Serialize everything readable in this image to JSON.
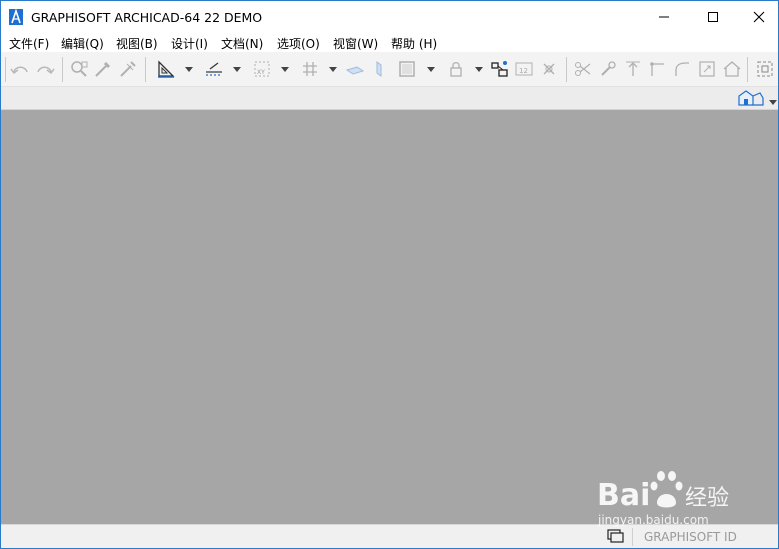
{
  "window": {
    "title": "GRAPHISOFT ARCHICAD-64 22 DEMO"
  },
  "menu": [
    {
      "label": "文件(F)"
    },
    {
      "label": "编辑(Q)"
    },
    {
      "label": "视图(B)"
    },
    {
      "label": "设计(I)"
    },
    {
      "label": "文档(N)"
    },
    {
      "label": "选项(O)"
    },
    {
      "label": "视窗(W)"
    },
    {
      "label": "帮助 (H)"
    }
  ],
  "statusbar": {
    "graphisoft_id": "GRAPHISOFT ID"
  },
  "watermark": {
    "brand": "Bai",
    "brand_suffix": "经验",
    "url": "jingyan.baidu.com"
  },
  "colors": {
    "workspace": "#a6a6a6",
    "toolbar": "#f3f3f3",
    "window_border": "#2b79c9",
    "accent_blue": "#1e6fd0"
  }
}
